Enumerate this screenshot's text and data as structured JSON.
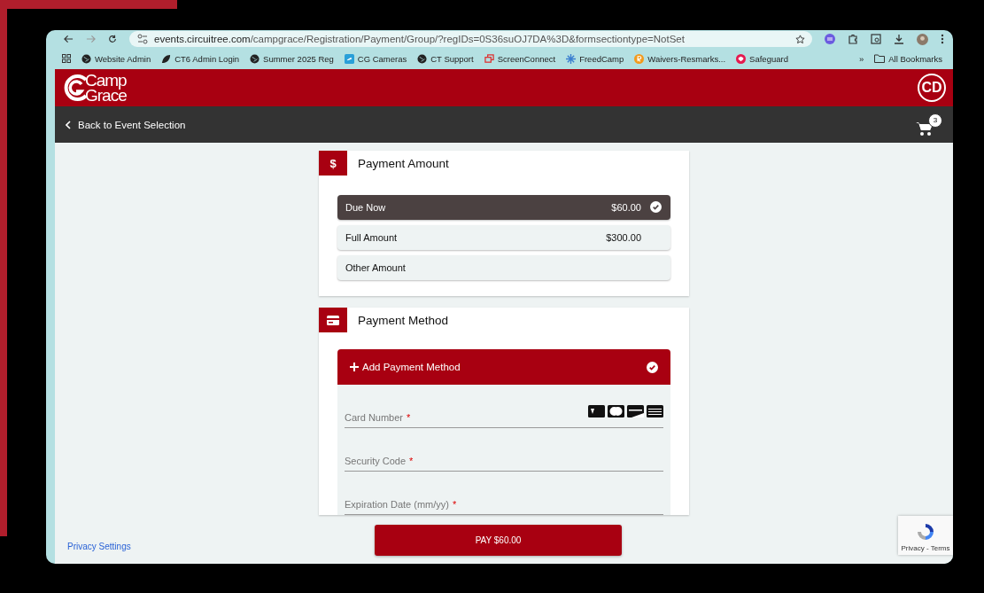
{
  "browser": {
    "url_host": "events.circuitree.com",
    "url_path": "/campgrace/Registration/Payment/Group/?regIDs=0S36suOJ7DA%3D&formsectiontype=NotSet",
    "bookmarks": [
      {
        "label": "Website Admin",
        "kind": "globe"
      },
      {
        "label": "CT6 Admin Login",
        "kind": "leaf"
      },
      {
        "label": "Summer 2025 Reg",
        "kind": "globe"
      },
      {
        "label": "CG Cameras",
        "kind": "camera"
      },
      {
        "label": "CT Support",
        "kind": "globe"
      },
      {
        "label": "ScreenConnect",
        "kind": "screens"
      },
      {
        "label": "FreedCamp",
        "kind": "snow"
      },
      {
        "label": "Waivers-Resmarks...",
        "kind": "orange"
      },
      {
        "label": "Safeguard",
        "kind": "pink"
      }
    ],
    "more": "»",
    "all_bookmarks": "All Bookmarks"
  },
  "header": {
    "logo_top": "Camp",
    "logo_bottom": "Grace",
    "avatar": "CD"
  },
  "nav": {
    "back": "Back to Event Selection",
    "cart_count": "3"
  },
  "payment_amount": {
    "icon": "$",
    "title": "Payment Amount",
    "options": [
      {
        "label": "Due Now",
        "amount": "$60.00",
        "selected": true
      },
      {
        "label": "Full Amount",
        "amount": "$300.00",
        "selected": false
      },
      {
        "label": "Other Amount",
        "selected": false
      }
    ]
  },
  "payment_method": {
    "title": "Payment Method",
    "add": {
      "label": "Add Payment Method",
      "checked": true
    },
    "fields": [
      {
        "label": "Card Number",
        "required_mark": "*",
        "kind": "card"
      },
      {
        "label": "Security Code",
        "required_mark": "*",
        "kind": "text"
      },
      {
        "label": "Expiration Date (mm/yy)",
        "required_mark": "*",
        "kind": "text"
      }
    ]
  },
  "footer": {
    "privacy": "Privacy Settings",
    "pay": "PAY $60.00",
    "recaptcha": "Privacy - Terms"
  }
}
